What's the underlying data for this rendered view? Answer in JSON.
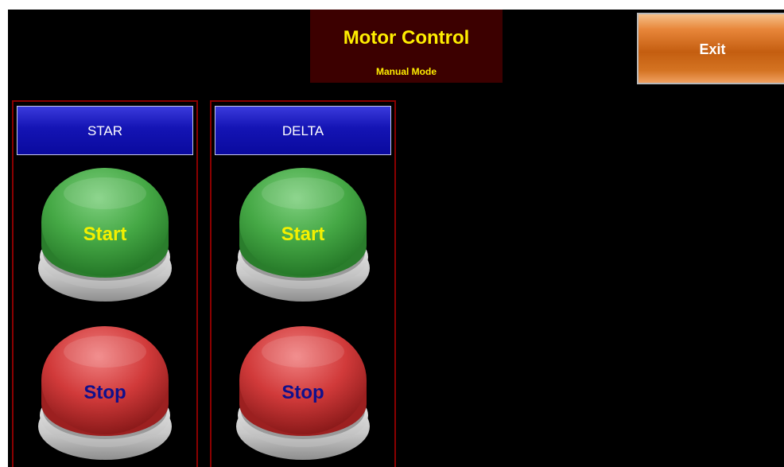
{
  "header": {
    "title": "Motor Control",
    "subtitle": "Manual Mode"
  },
  "exit_button": {
    "label": "Exit"
  },
  "panels": [
    {
      "label": "STAR",
      "start_label": "Start",
      "stop_label": "Stop"
    },
    {
      "label": "DELTA",
      "start_label": "Start",
      "stop_label": "Stop"
    }
  ],
  "colors": {
    "background": "#000000",
    "title_panel": "#3c0000",
    "title_text": "#ffee00",
    "panel_border": "#8a0000",
    "header_blue": "#1414b4",
    "start_green": "#4caf50",
    "stop_red": "#d13a3a",
    "start_text": "#f4f000",
    "stop_text": "#10108c",
    "exit_orange": "#d4701e"
  }
}
